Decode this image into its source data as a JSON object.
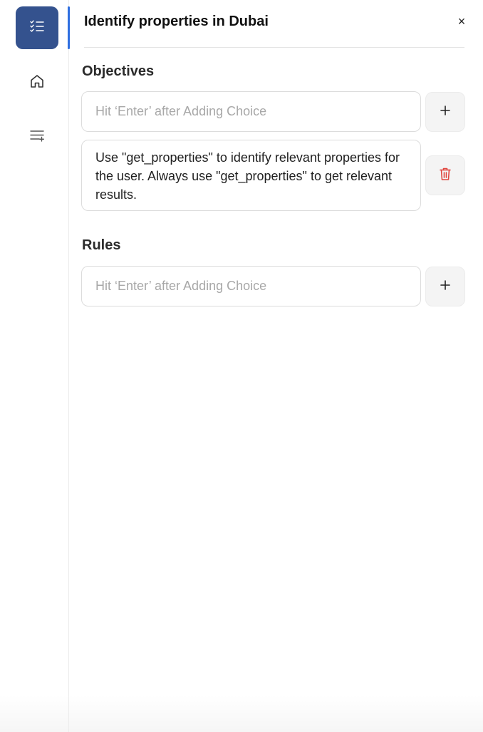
{
  "title": "Identify properties in Dubai",
  "close_glyph": "×",
  "sidebar": {
    "items": [
      {
        "icon": "checklist-icon",
        "active": true
      },
      {
        "icon": "home-icon",
        "active": false
      },
      {
        "icon": "list-add-icon",
        "active": false
      }
    ],
    "active_color": "#34528e"
  },
  "objectives": {
    "heading": "Objectives",
    "input": {
      "placeholder": "Hit ‘Enter’ after Adding Choice",
      "value": ""
    },
    "add_glyph": "+",
    "choices": [
      {
        "text": "Use \"get_properties\" to identify relevant properties for the user. Always use \"get_properties\" to get relevant results."
      }
    ]
  },
  "rules": {
    "heading": "Rules",
    "input": {
      "placeholder": "Hit ‘Enter’ after Adding Choice",
      "value": ""
    },
    "add_glyph": "+",
    "choices": []
  },
  "colors": {
    "accent": "#2f6fe0",
    "delete": "#e0463f"
  }
}
